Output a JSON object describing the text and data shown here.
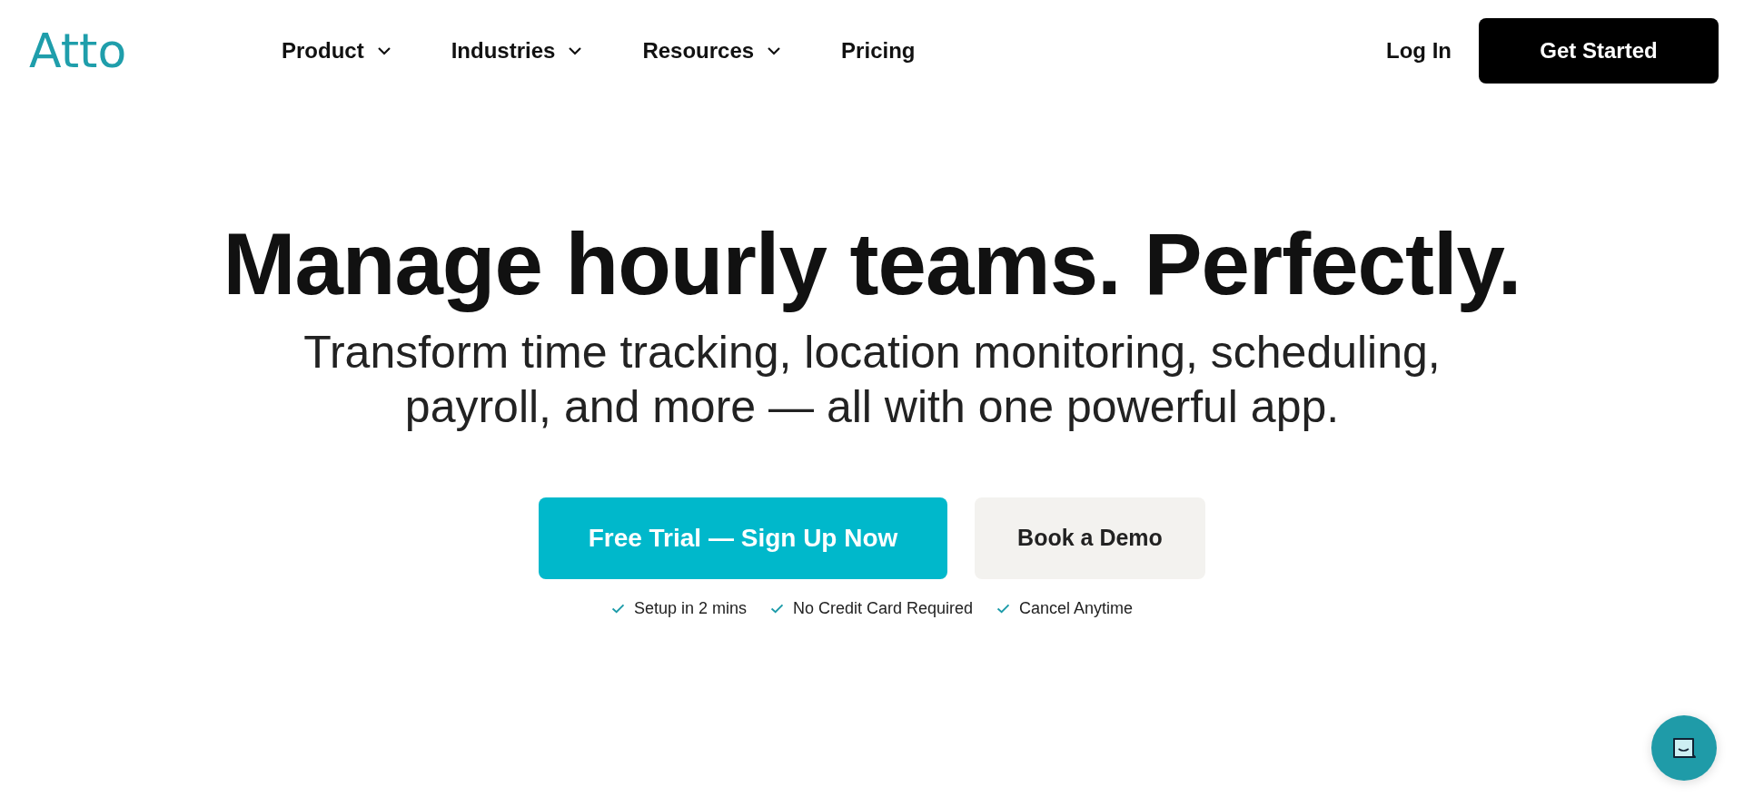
{
  "logo": "Atto",
  "nav": [
    {
      "label": "Product",
      "has_menu": true
    },
    {
      "label": "Industries",
      "has_menu": true
    },
    {
      "label": "Resources",
      "has_menu": true
    },
    {
      "label": "Pricing",
      "has_menu": false
    }
  ],
  "login": "Log In",
  "get_started": "Get Started",
  "headline": "Manage hourly teams. Perfectly.",
  "subtitle": "Transform time tracking, location monitoring, scheduling, payroll, and more — all with one powerful app.",
  "cta_primary": "Free Trial — Sign Up Now",
  "cta_secondary": "Book a Demo",
  "benefits": [
    "Setup in 2 mins",
    "No Credit Card Required",
    "Cancel Anytime"
  ]
}
